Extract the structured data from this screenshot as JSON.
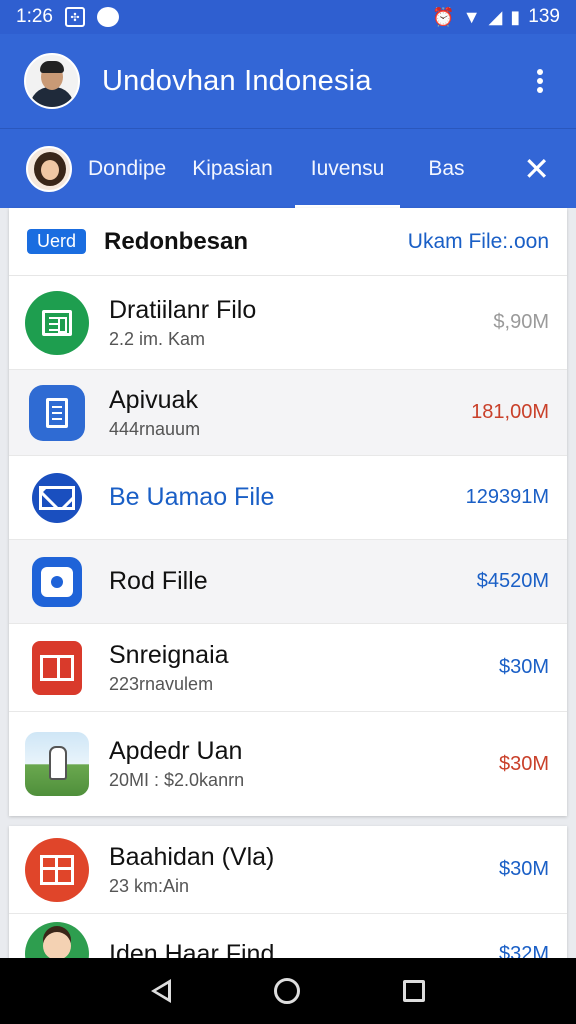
{
  "status_bar": {
    "time": "1:26",
    "battery": "139",
    "left_icon_box": "✣"
  },
  "app_bar": {
    "title": "Undovhan Indonesia"
  },
  "tabs": [
    {
      "label": "Dondipe"
    },
    {
      "label": "Kipasian"
    },
    {
      "label": "Iuvensu"
    },
    {
      "label": "Bas"
    }
  ],
  "list_header": {
    "badge": "Uerd",
    "title": "Redonbesan",
    "link": "Ukam File:.oon"
  },
  "files": [
    {
      "name": "Dratiilanr Filo",
      "sub": "2.2 im. Kam",
      "size": "$,90M",
      "size_color": "#9a9a9a",
      "icon": "doc-icon",
      "icon_bg": "#1e9e4f"
    },
    {
      "name": "Apivuak",
      "sub": "444rnauum",
      "size": "181,00M",
      "size_color": "#c9402a",
      "icon": "sheet-icon",
      "icon_bg": "#2f6bd3"
    },
    {
      "name": "Be Uamao File",
      "sub": "",
      "size": "129391M",
      "size_color": "#1a5fc6",
      "icon": "mail-icon",
      "icon_bg": "#1a4fbf"
    },
    {
      "name": "Rod Fille",
      "sub": "",
      "size": "$4520M",
      "size_color": "#1a5fc6",
      "icon": "chat-icon",
      "icon_bg": "#1f63d8"
    },
    {
      "name": "Snreignaia",
      "sub": "223rnavulem",
      "size": "$30M",
      "size_color": "#1a5fc6",
      "icon": "book-icon",
      "icon_bg": "#d93a2b"
    },
    {
      "name": "Apdedr Uan",
      "sub": "20MI : $2.0kanrn",
      "size": "$30M",
      "size_color": "#c9402a",
      "icon": "photo-icon",
      "icon_bg": "#9cc8e8"
    }
  ],
  "files_more": [
    {
      "name": "Baahidan (Vla)",
      "sub": "23 km:Ain",
      "size": "$30M",
      "size_color": "#1a5fc6",
      "icon": "grid-icon",
      "icon_bg": "#e0452a"
    },
    {
      "name": "Iden Haar Find",
      "sub": "",
      "size": "$32M",
      "size_color": "#1a5fc6",
      "icon": "person-icon",
      "icon_bg": "#2e9e4f"
    }
  ]
}
